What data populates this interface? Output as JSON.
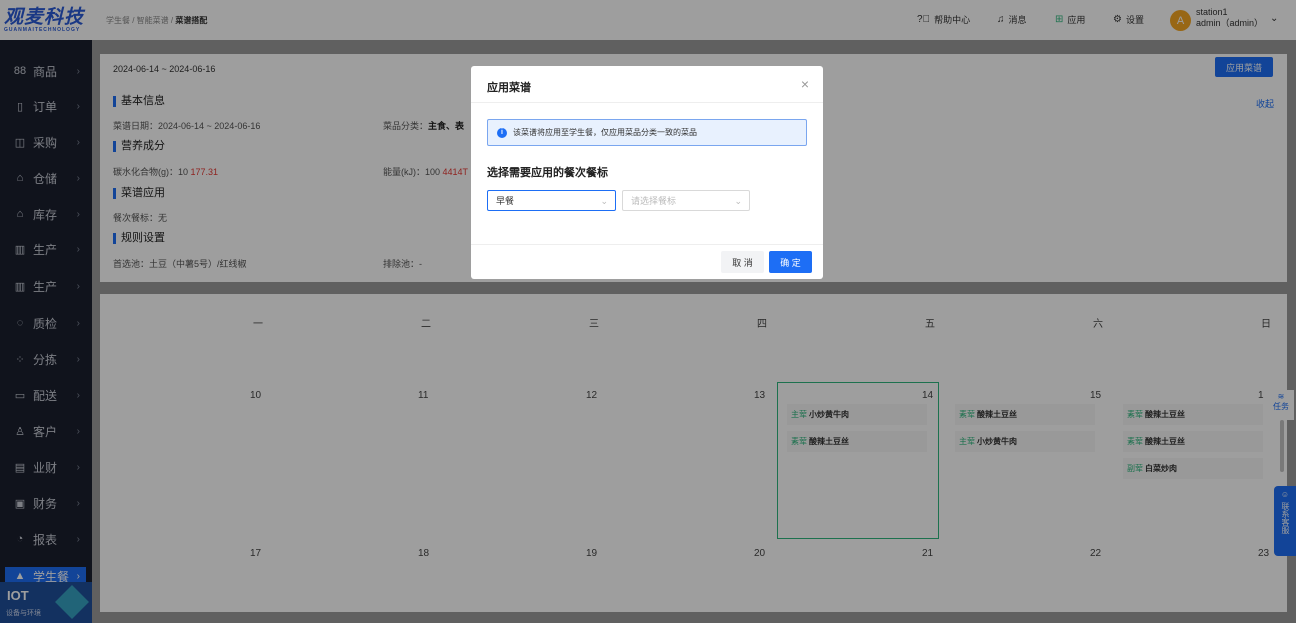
{
  "logo": {
    "zh": "观麦科技",
    "en": "GUANMAITECHNOLOGY"
  },
  "breadcrumb": [
    "学生餐",
    "智能菜谱",
    "菜谱搭配"
  ],
  "header": {
    "help": "帮助中心",
    "messages": "消息",
    "apps": "应用",
    "settings": "设置",
    "avatar_letter": "A",
    "station": "station1",
    "user": "admin（admin）"
  },
  "sidebar": {
    "items": [
      {
        "icon": "88",
        "label": "商品"
      },
      {
        "icon": "▯",
        "label": "订单"
      },
      {
        "icon": "◫",
        "label": "采购"
      },
      {
        "icon": "⌂",
        "label": "仓储"
      },
      {
        "icon": "⌂",
        "label": "库存"
      },
      {
        "icon": "▥",
        "label": "生产"
      },
      {
        "icon": "▥",
        "label": "生产"
      },
      {
        "icon": "◌",
        "label": "质检"
      },
      {
        "icon": "⁘",
        "label": "分拣"
      },
      {
        "icon": "▭",
        "label": "配送"
      },
      {
        "icon": "♙",
        "label": "客户"
      },
      {
        "icon": "▤",
        "label": "业财"
      },
      {
        "icon": "▣",
        "label": "财务"
      },
      {
        "icon": "◔",
        "label": "报表"
      },
      {
        "icon": "▲",
        "label": "学生餐"
      }
    ],
    "iot_title": "IOT",
    "iot_sub": "设备与环境"
  },
  "panel": {
    "date_range": "2024-06-14 ~ 2024-06-16",
    "apply_button": "应用菜谱",
    "collapse": "收起",
    "basic_info": "基本信息",
    "menu_date": "菜谱日期：2024-06-14 ~ 2024-06-16",
    "category_label": "菜品分类：",
    "category_value": "主食、表",
    "nutrition": "营养成分",
    "carb_label": "碳水化合物(g)：10",
    "carb_value": "177.31",
    "energy_label": "能量(kJ)：100",
    "energy_value": "4414T",
    "menu_apply": "菜谱应用",
    "meal_tag": "餐次餐标：无",
    "rules": "规则设置",
    "preferred": "首选池：土豆（中薯5号）/红线椒",
    "excluded": "排除池：-"
  },
  "calendar": {
    "weekdays": [
      "一",
      "二",
      "三",
      "四",
      "五",
      "六",
      "日"
    ],
    "week1": [
      "10",
      "11",
      "12",
      "13",
      "14",
      "15",
      "1"
    ],
    "week2": [
      "17",
      "18",
      "19",
      "20",
      "21",
      "22",
      "23"
    ],
    "dishes": {
      "d14": [
        {
          "tag": "主荤",
          "name": "小炒黄牛肉"
        },
        {
          "tag": "素荤",
          "name": "酸辣土豆丝"
        }
      ],
      "d15": [
        {
          "tag": "素荤",
          "name": "酸辣土豆丝"
        },
        {
          "tag": "主荤",
          "name": "小炒黄牛肉"
        }
      ],
      "d16": [
        {
          "tag": "素荤",
          "name": "酸辣土豆丝"
        },
        {
          "tag": "素荤",
          "name": "酸辣土豆丝"
        },
        {
          "tag": "副荤",
          "name": "白菜炒肉"
        }
      ]
    }
  },
  "side": {
    "task": "任务",
    "support": "联系客服"
  },
  "modal": {
    "title": "应用菜谱",
    "alert": "该菜谱将应用至学生餐，仅应用菜品分类一致的菜品",
    "label": "选择需要应用的餐次餐标",
    "meal_value": "早餐",
    "tag_placeholder": "请选择餐标",
    "cancel": "取 消",
    "confirm": "确 定"
  },
  "colors": {
    "primary": "#1d6ef5",
    "green": "#2fb77f",
    "sidebar": "#1a1f2e"
  }
}
